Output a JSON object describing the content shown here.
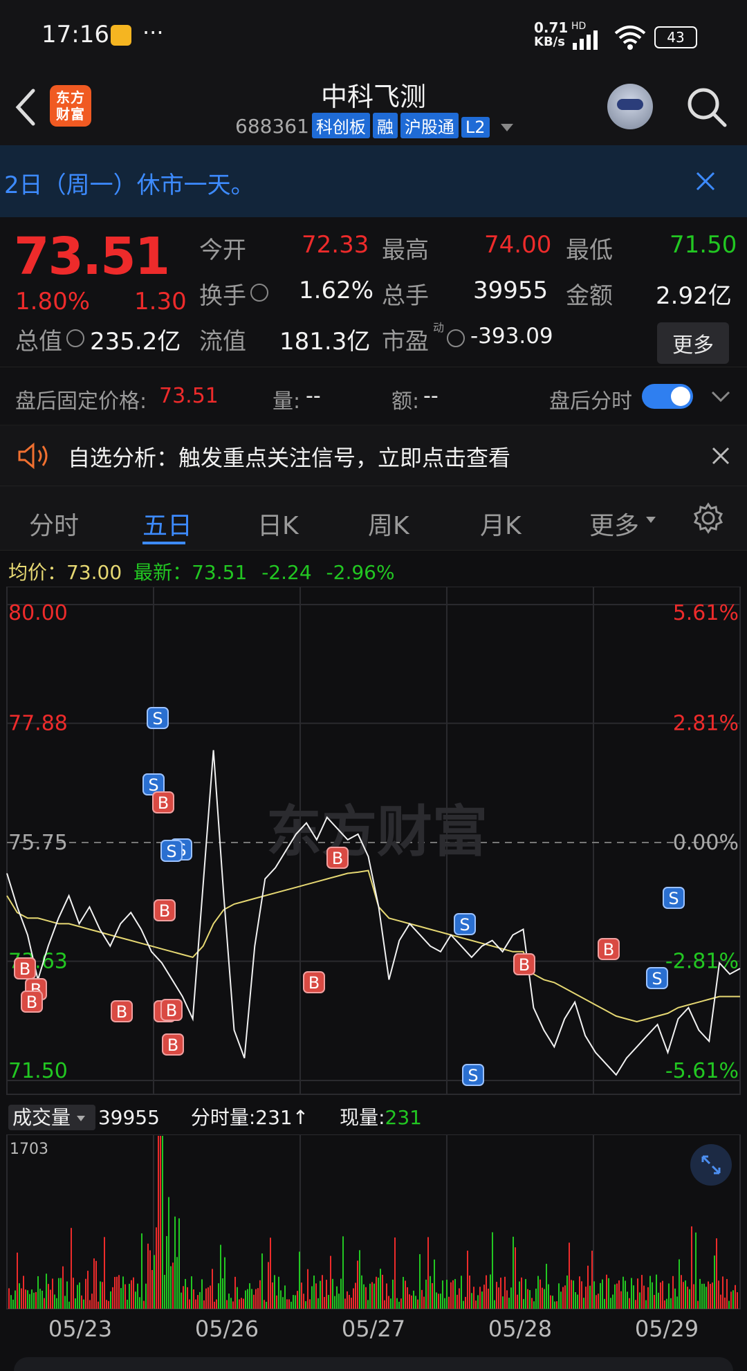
{
  "status_bar": {
    "time": "17:16",
    "dots": "···",
    "net_speed_value": "0.71",
    "net_speed_unit": "KB/s",
    "hd_label": "HD",
    "battery": "43"
  },
  "header": {
    "title": "中科飞测",
    "code": "688361",
    "tags": [
      "科创板",
      "融",
      "沪股通",
      "L2"
    ],
    "logo_text": "东方财富"
  },
  "notice": {
    "text": "2日（周一）休市一天。"
  },
  "quote": {
    "price": "73.51",
    "change_pct": "1.80%",
    "change": "1.30",
    "open_label": "今开",
    "open": "72.33",
    "high_label": "最高",
    "high": "74.00",
    "low_label": "最低",
    "low": "71.50",
    "turnover_label": "换手",
    "turnover": "1.62%",
    "volume_label": "总手",
    "volume": "39955",
    "amount_label": "金额",
    "amount": "2.92亿",
    "mcap_label": "总值",
    "mcap": "235.2亿",
    "float_label": "流值",
    "float": "181.3亿",
    "pe_label": "市盈",
    "pe_sup": "动",
    "pe": "-393.09",
    "more_label": "更多"
  },
  "after_hours": {
    "price_label": "盘后固定价格:",
    "price": "73.51",
    "vol_label": "量:",
    "vol": "--",
    "amt_label": "额:",
    "amt": "--",
    "toggle_label": "盘后分时",
    "toggle_on": true
  },
  "alert": {
    "text": "自选分析：触发重点关注信号，立即点击查看"
  },
  "tabs": [
    "分时",
    "五日",
    "日K",
    "周K",
    "月K",
    "更多"
  ],
  "active_tab": 1,
  "chart_info": {
    "avg_label": "均价：",
    "avg": "73.00",
    "last_label": "最新：",
    "last": "73.51",
    "chg": "-2.24",
    "chg_pct": "-2.96%"
  },
  "volume_info": {
    "label": "成交量",
    "total": "39955",
    "tick_label": "分时量:",
    "tick": "231↑",
    "now_label": "现量:",
    "now": "231"
  },
  "colors": {
    "up": "#ee2b2b",
    "down": "#22c722",
    "accent": "#3d8bff",
    "avg_line": "#e6d873",
    "price_line": "#f2f2f2"
  },
  "chart_data": {
    "type": "line",
    "price_axis": {
      "ticks": [
        "80.00",
        "77.88",
        "75.75",
        "73.63",
        "71.50"
      ],
      "ylim": [
        71.5,
        80.0
      ]
    },
    "pct_axis": {
      "ticks": [
        "5.61%",
        "2.81%",
        "0.00%",
        "-2.81%",
        "-5.61%"
      ]
    },
    "x_labels": [
      "05/23",
      "05/26",
      "05/27",
      "05/28",
      "05/29"
    ],
    "volume_axis_max": "1703",
    "series": [
      {
        "name": "最新",
        "values": [
          75.2,
          74.6,
          74.1,
          73.3,
          73.9,
          74.4,
          74.8,
          74.3,
          74.6,
          74.2,
          73.9,
          74.3,
          74.5,
          74.2,
          73.8,
          73.6,
          73.3,
          73.0,
          72.6,
          75.0,
          77.4,
          74.8,
          72.4,
          71.9,
          73.9,
          75.1,
          75.3,
          75.6,
          75.9,
          76.1,
          75.8,
          76.2,
          76.0,
          75.8,
          75.9,
          75.5,
          74.6,
          73.3,
          74.0,
          74.3,
          74.1,
          73.9,
          73.8,
          74.1,
          73.9,
          73.7,
          73.9,
          74.0,
          73.8,
          74.1,
          74.2,
          72.8,
          72.4,
          72.1,
          72.6,
          72.9,
          72.3,
          72.0,
          71.8,
          71.6,
          71.9,
          72.1,
          72.3,
          72.5,
          72.0,
          72.6,
          72.8,
          72.4,
          72.2,
          73.6,
          73.4,
          73.5
        ]
      },
      {
        "name": "均价",
        "values": [
          74.8,
          74.5,
          74.4,
          74.4,
          74.35,
          74.3,
          74.3,
          74.25,
          74.2,
          74.15,
          74.1,
          74.05,
          74.0,
          73.95,
          73.9,
          73.85,
          73.8,
          73.75,
          73.7,
          73.9,
          74.3,
          74.55,
          74.65,
          74.7,
          74.75,
          74.8,
          74.85,
          74.9,
          74.95,
          75.0,
          75.05,
          75.1,
          75.15,
          75.2,
          75.22,
          75.25,
          74.6,
          74.4,
          74.35,
          74.3,
          74.25,
          74.2,
          74.15,
          74.1,
          74.05,
          74.0,
          73.95,
          73.9,
          73.85,
          73.8,
          73.8,
          73.4,
          73.3,
          73.25,
          73.15,
          73.05,
          72.95,
          72.85,
          72.75,
          72.65,
          72.6,
          72.55,
          72.6,
          72.65,
          72.7,
          72.8,
          72.85,
          72.9,
          72.95,
          73.0,
          73.0,
          73.0
        ]
      }
    ],
    "marker_types": [
      "B",
      "B",
      "B",
      "B",
      "B",
      "B",
      "S",
      "S",
      "S",
      "B",
      "B",
      "B",
      "B",
      "S",
      "S",
      "B",
      "B",
      "S",
      "S",
      "B",
      "S"
    ]
  }
}
